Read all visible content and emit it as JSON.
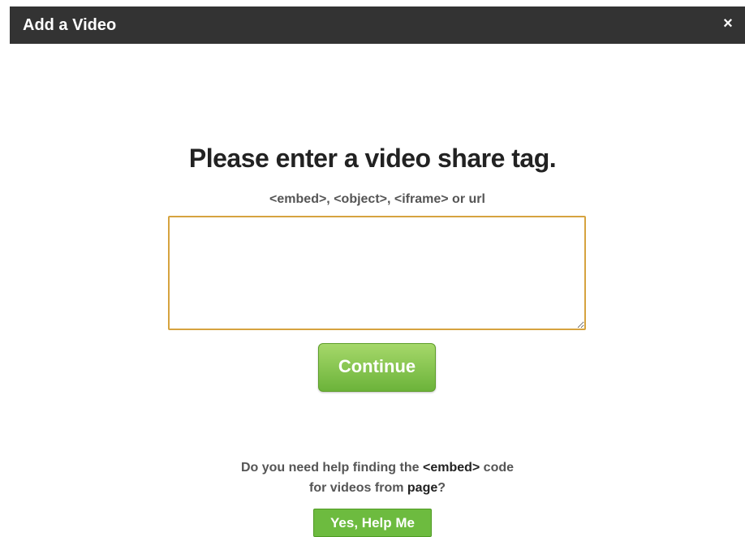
{
  "dialog": {
    "title": "Add a Video",
    "close_label": "×"
  },
  "main": {
    "heading": "Please enter a video share tag.",
    "subheading": "<embed>, <object>, <iframe> or url",
    "tag_input": {
      "value": "",
      "placeholder": ""
    },
    "continue_label": "Continue"
  },
  "help": {
    "line1_prefix": "Do you need help finding the ",
    "line1_code": "<embed>",
    "line1_suffix": " code",
    "line2_prefix": "for videos from ",
    "line2_site": "page",
    "line2_suffix": "?",
    "button_label": "Yes, Help Me"
  },
  "colors": {
    "titlebar": "#333333",
    "input_focus_border": "#d6a33f",
    "button_green": "#6dbb3f"
  }
}
